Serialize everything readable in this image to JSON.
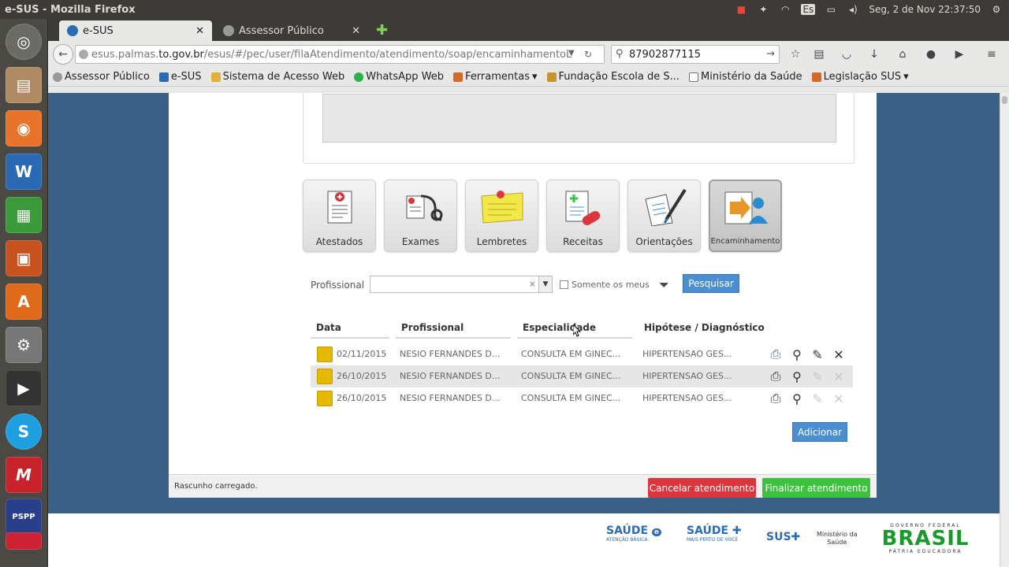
{
  "os": {
    "window_title": "e-SUS - Mozilla Firefox",
    "keyboard_layout": "Es",
    "datetime": "Seg, 2 de Nov 22:37:50"
  },
  "browser": {
    "tabs": [
      {
        "title": "e-SUS",
        "active": true
      },
      {
        "title": "Assessor Público",
        "active": false
      }
    ],
    "url_prefix": "esus.palmas.",
    "url_domain": "to.gov.br",
    "url_path": "/esus/#/pec/user/filaAtendimento/atendimento/soap/encaminhamentoL",
    "search_value": "87902877115",
    "bookmarks": [
      "Assessor Público",
      "e-SUS",
      "Sistema de Acesso Web",
      "WhatsApp Web",
      "Ferramentas",
      "Fundação Escola de S...",
      "Ministério da Saúde",
      "Legislação SUS"
    ]
  },
  "page": {
    "tiles": [
      {
        "label": "Atestados"
      },
      {
        "label": "Exames"
      },
      {
        "label": "Lembretes"
      },
      {
        "label": "Receitas"
      },
      {
        "label": "Orientações"
      },
      {
        "label": "Encaminhamento"
      }
    ],
    "filter": {
      "profissional_label": "Profissional",
      "profissional_value": "",
      "clear_glyph": "×",
      "somente_meus_label": "Somente os meus",
      "search_button": "Pesquisar"
    },
    "grid": {
      "headers": [
        "Data",
        "Profissional",
        "Especialidade",
        "Hipótese / Diagnóstico"
      ],
      "rows": [
        {
          "data": "02/11/2015",
          "profissional": "NESIO FERNANDES D...",
          "especialidade": "CONSULTA EM GINEC...",
          "hipotese": "HIPERTENSAO GES...",
          "editable": true
        },
        {
          "data": "26/10/2015",
          "profissional": "NESIO FERNANDES D...",
          "especialidade": "CONSULTA EM GINEC...",
          "hipotese": "HIPERTENSAO GES...",
          "editable": false
        },
        {
          "data": "26/10/2015",
          "profissional": "NESIO FERNANDES D...",
          "especialidade": "CONSULTA EM GINEC...",
          "hipotese": "HIPERTENSAO GES...",
          "editable": false
        }
      ]
    },
    "add_button": "Adicionar",
    "status_text": "Rascunho carregado.",
    "cancel_button": "Cancelar atendimento",
    "finish_button": "Finalizar atendimento"
  },
  "footer_logos": {
    "saude_ab": "SAÚDE",
    "saude_ab_sub": "ATENÇÃO BÁSICA",
    "saude_mpv": "SAÚDE",
    "saude_mpv_sub": "MAIS PERTO DE VOCÊ",
    "sus": "SUS",
    "ministerio_line1": "Ministério da",
    "ministerio_line2": "Saúde",
    "gov_federal": "GOVERNO FEDERAL",
    "brasil": "BRASIL",
    "patria": "PÁTRIA EDUCADORA"
  },
  "colors": {
    "accent": "#4b8fd0",
    "cancel": "#d9363e",
    "finish": "#3cc23c",
    "page_bg": "#3a6185",
    "folder": "#e6b800"
  }
}
